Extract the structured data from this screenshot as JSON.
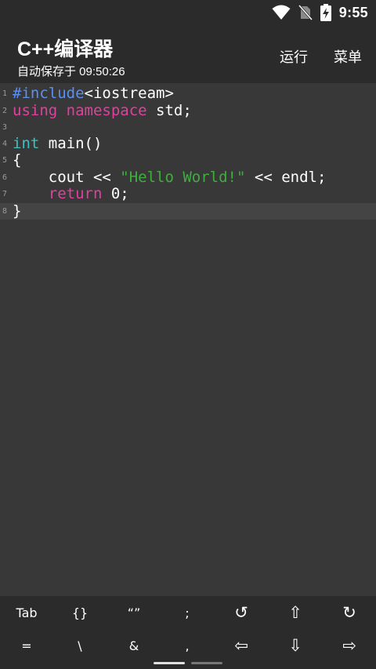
{
  "status_bar": {
    "time": "9:55",
    "icons": [
      "wifi-icon",
      "no-sim-icon",
      "battery-charging-icon"
    ]
  },
  "app_bar": {
    "title": "C++编译器",
    "subtitle": "自动保存于 09:50:26",
    "run_label": "运行",
    "menu_label": "菜单"
  },
  "editor": {
    "current_line": 8,
    "lines": [
      {
        "num": "1",
        "tokens": [
          {
            "t": "#include",
            "c": "pre"
          },
          {
            "t": "<iostream>",
            "c": "plain"
          }
        ]
      },
      {
        "num": "2",
        "tokens": [
          {
            "t": "using",
            "c": "kw"
          },
          {
            "t": " ",
            "c": "plain"
          },
          {
            "t": "namespace",
            "c": "kw"
          },
          {
            "t": " std;",
            "c": "plain"
          }
        ]
      },
      {
        "num": "3",
        "tokens": []
      },
      {
        "num": "4",
        "tokens": [
          {
            "t": "int",
            "c": "type"
          },
          {
            "t": " main()",
            "c": "plain"
          }
        ]
      },
      {
        "num": "5",
        "tokens": [
          {
            "t": "{",
            "c": "plain"
          }
        ]
      },
      {
        "num": "6",
        "tokens": [
          {
            "t": "    cout << ",
            "c": "plain"
          },
          {
            "t": "\"Hello World!\"",
            "c": "str"
          },
          {
            "t": " << endl;",
            "c": "plain"
          }
        ]
      },
      {
        "num": "7",
        "tokens": [
          {
            "t": "    ",
            "c": "plain"
          },
          {
            "t": "return",
            "c": "kw"
          },
          {
            "t": " 0;",
            "c": "plain"
          }
        ]
      },
      {
        "num": "8",
        "tokens": [
          {
            "t": "}",
            "c": "plain"
          }
        ]
      }
    ]
  },
  "symbol_keys": {
    "row1": [
      {
        "label": "Tab",
        "name": "tab-key"
      },
      {
        "label": "{}",
        "name": "braces-key"
      },
      {
        "label": "“”",
        "name": "quotes-key"
      },
      {
        "label": ";",
        "name": "semicolon-key"
      },
      {
        "label": "↺",
        "name": "undo-icon"
      },
      {
        "label": "⇧",
        "name": "arrow-up-icon"
      },
      {
        "label": "↻",
        "name": "redo-icon"
      }
    ],
    "row2": [
      {
        "label": "=",
        "name": "equals-key"
      },
      {
        "label": "\\",
        "name": "backslash-key"
      },
      {
        "label": "&",
        "name": "ampersand-key"
      },
      {
        "label": ",",
        "name": "comma-key"
      },
      {
        "label": "⇦",
        "name": "arrow-left-icon"
      },
      {
        "label": "⇩",
        "name": "arrow-down-icon"
      },
      {
        "label": "⇨",
        "name": "arrow-right-icon"
      }
    ]
  },
  "colors": {
    "preprocessor": "#5b8ff0",
    "keyword": "#e040a0",
    "type": "#40c0c0",
    "string": "#3fae3f",
    "background": "#383838",
    "bars": "#2b2b2b"
  }
}
